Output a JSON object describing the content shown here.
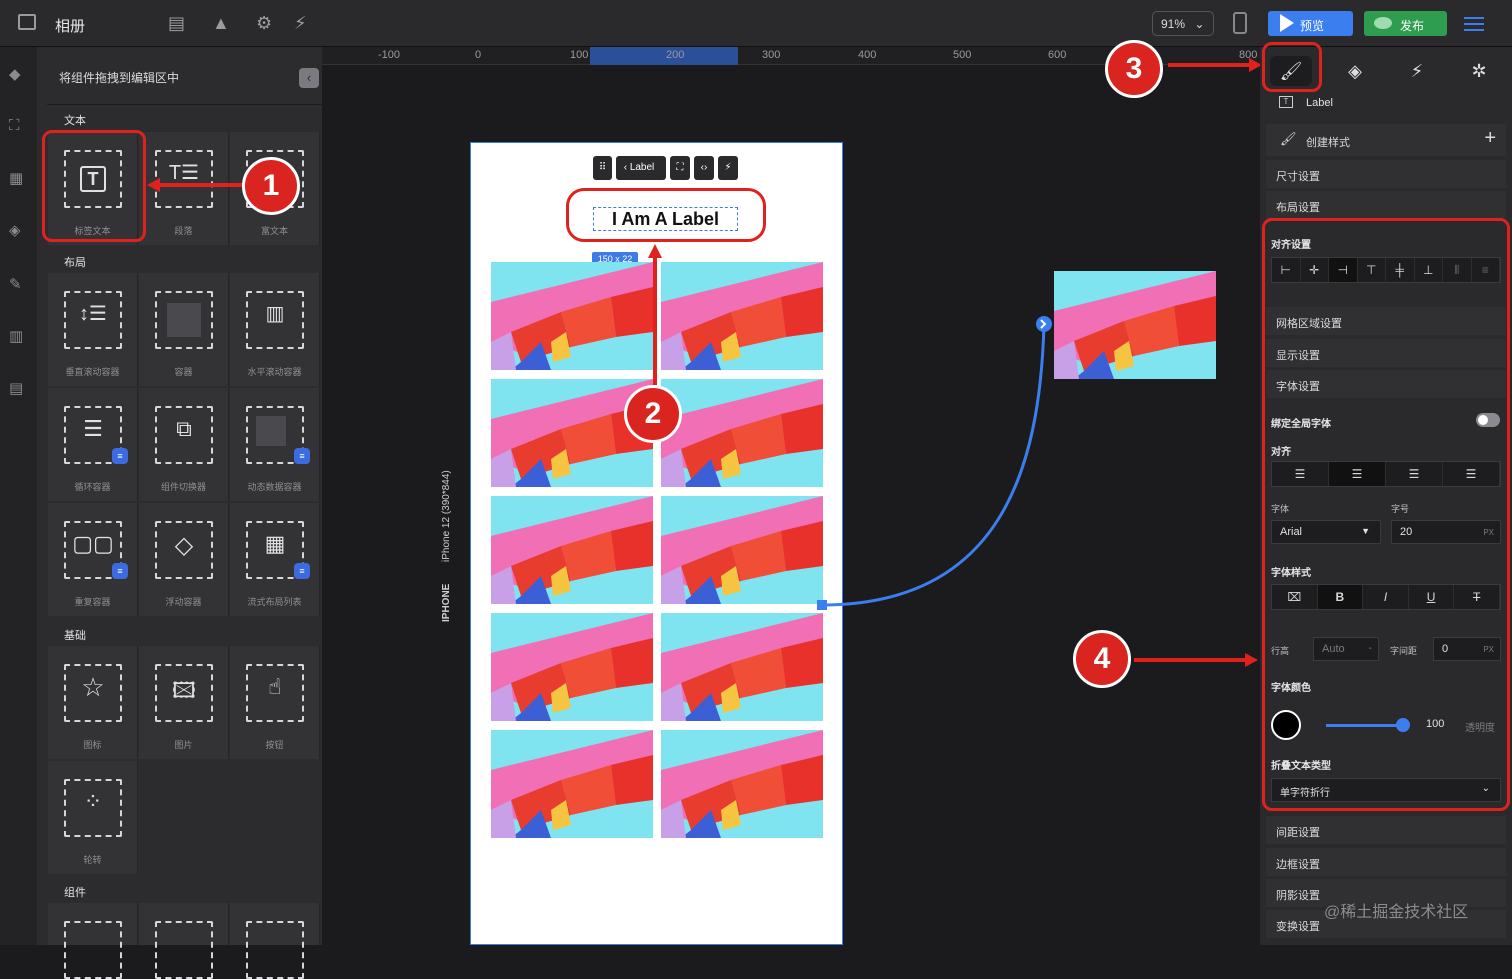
{
  "topbar": {
    "title": "相册",
    "zoom": "91%",
    "preview_label": "预览",
    "publish_label": "发布"
  },
  "left_panel": {
    "header": "将组件拖拽到编辑区中",
    "sections": {
      "text": "文本",
      "layout": "布局",
      "basic": "基础",
      "components": "组件"
    },
    "text_items": [
      "标签文本",
      "段落",
      "富文本"
    ],
    "layout_items": [
      "垂直滚动容器",
      "容器",
      "水平滚动容器",
      "循环容器",
      "组件切换器",
      "动态数据容器",
      "重复容器",
      "浮动容器",
      "流式布局列表"
    ],
    "basic_items": [
      "图标",
      "图片",
      "按钮",
      "轮转"
    ]
  },
  "ruler": {
    "ticks": [
      "-100",
      "0",
      "100",
      "200",
      "300",
      "400",
      "500",
      "600",
      "800"
    ]
  },
  "canvas": {
    "device_label": "IPHONE",
    "device_model": "iPhone 12 (390*844)",
    "toolbar_label": "Label",
    "label_text": "I Am A Label",
    "size_badge": "150 x 22"
  },
  "right_panel": {
    "selected_component": "Label",
    "create_style": "创建样式",
    "rows": {
      "size": "尺寸设置",
      "layout": "布局设置",
      "grid_area": "网格区域设置",
      "display": "显示设置",
      "font": "字体设置",
      "spacing": "间距设置",
      "border": "边框设置",
      "shadow": "阴影设置",
      "transform": "变换设置"
    },
    "align_settings": "对齐设置",
    "bind_global_font": "绑定全局字体",
    "bind_global_font_on": false,
    "text_align": "对齐",
    "font_family_label": "字体",
    "font_family": "Arial",
    "font_size_label": "字号",
    "font_size": "20",
    "unit_px": "PX",
    "font_style": "字体样式",
    "line_height_label": "行高",
    "line_height": "Auto",
    "letter_spacing_label": "字间距",
    "letter_spacing": "0",
    "font_color": "字体颜色",
    "font_color_value": "#000000",
    "opacity": "100",
    "opacity_label": "透明度",
    "opacity_fraction": 1.0,
    "wrap_type": "折叠文本类型",
    "wrap_value": "单字符折行"
  },
  "annotations": [
    "1",
    "2",
    "3",
    "4"
  ],
  "watermark": "@稀土掘金技术社区",
  "colors": {
    "accent": "#3d7ce8",
    "annotation": "#e0221f",
    "preview": "#3a7ef0",
    "publish": "#2f9d4f"
  }
}
